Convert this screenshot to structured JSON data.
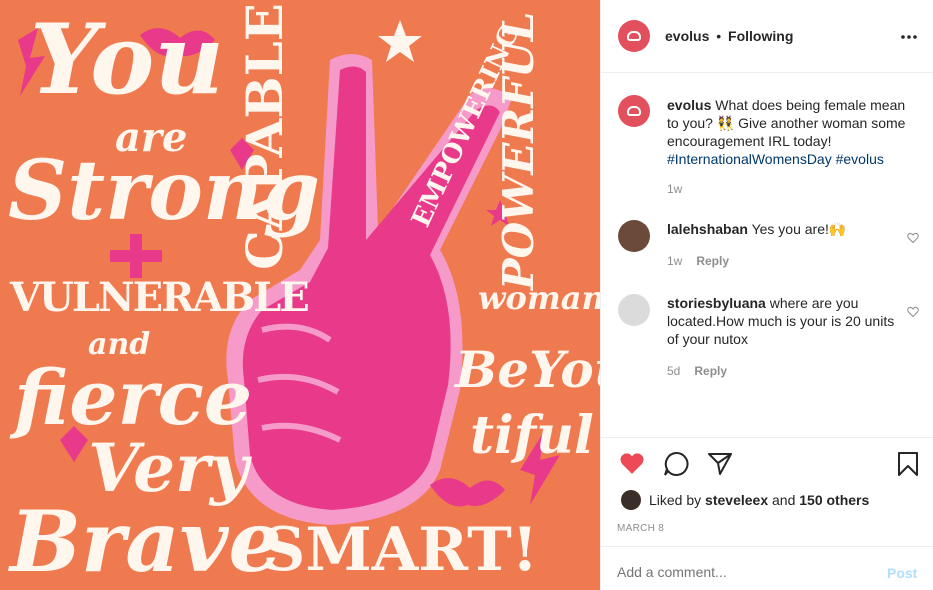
{
  "header": {
    "username": "evolus",
    "dot": "•",
    "follow_label": "Following",
    "more_icon": "more-horizontal-icon"
  },
  "caption": {
    "username": "evolus",
    "text": "What does being female mean to you? 👯 Give another woman some encouragement IRL today!",
    "hashtags": "#InternationalWomensDay #evolus",
    "time": "1w"
  },
  "comments": [
    {
      "username": "lalehshaban",
      "text": "Yes you are!🙌",
      "time": "1w",
      "reply_label": "Reply"
    },
    {
      "username": "storiesbyluana",
      "text": "where are you located.How much is your is 20 units of your nutox",
      "time": "5d",
      "reply_label": "Reply"
    }
  ],
  "actions": {
    "like_color": "#ed4956"
  },
  "likes": {
    "prefix": "Liked by",
    "user": "steveleex",
    "and": "and",
    "others": "150 others"
  },
  "date": "MARCH 8",
  "comment_box": {
    "placeholder": "Add a comment...",
    "post_label": "Post"
  },
  "poster": {
    "words": [
      "You",
      "are",
      "Strong",
      "VULNERABLE",
      "and",
      "fierce",
      "Very",
      "Brave",
      "CAPABLE",
      "EMPOWERING",
      "POWERFUL",
      "woman",
      "BeYou",
      "tiful",
      "SMART!"
    ]
  },
  "colors": {
    "poster_bg": "#f07a4f",
    "hand": "#e8398a",
    "hand_light": "#f59ac9",
    "brand": "#e3505d"
  }
}
